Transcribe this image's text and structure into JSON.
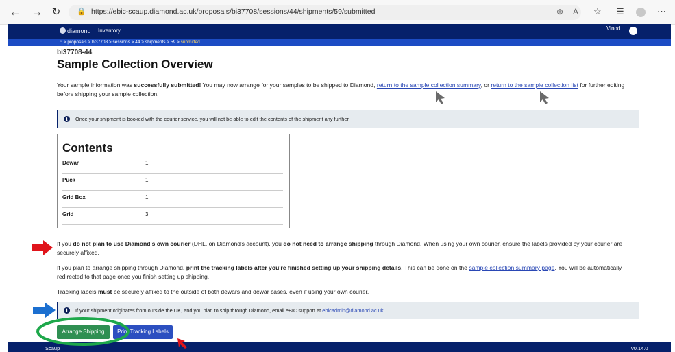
{
  "browser": {
    "url": "https://ebic-scaup.diamond.ac.uk/proposals/bi37708/sessions/44/shipments/59/submitted",
    "back_icon": "back-arrow-icon",
    "forward_icon": "forward-arrow-icon",
    "reload_icon": "reload-icon",
    "lock_icon": "lock-icon"
  },
  "app": {
    "logo_text": "diamond",
    "nav_inventory": "Inventory",
    "user_name": "Vinod",
    "accent_color": "#06216b",
    "crumb_color": "#1c4cc4"
  },
  "breadcrumb": {
    "home": "⌂",
    "sep": ">",
    "items": [
      "proposals",
      "bi37708",
      "sessions",
      "44",
      "shipments",
      "59",
      "submitted"
    ]
  },
  "page": {
    "proposal_session": "bi37708-44",
    "title": "Sample Collection Overview",
    "intro_pre": "Your sample information was ",
    "intro_bold": "successfully submitted!",
    "intro_mid": " You may now arrange for your samples to be shipped to Diamond, ",
    "intro_link1": "return to the sample collection summary",
    "intro_or": ", or ",
    "intro_link2": "return to the sample collection list",
    "intro_post": " for further editing before shipping your sample collection.",
    "alert_edit": "Once your shipment is booked with the courier service, you will not be able to edit the contents of the shipment any further.",
    "contents_title": "Contents",
    "contents": [
      {
        "label": "Dewar",
        "value": "1"
      },
      {
        "label": "Puck",
        "value": "1"
      },
      {
        "label": "Grid Box",
        "value": "1"
      },
      {
        "label": "Grid",
        "value": "3"
      }
    ],
    "p1_a": "If you ",
    "p1_b": "do not plan to use Diamond's own courier",
    "p1_c": " (DHL, on Diamond's account), you ",
    "p1_d": "do not need to arrange shipping",
    "p1_e": " through Diamond. When using your own courier, ensure the labels provided by your courier are securely affixed.",
    "p2_a": "If you plan to arrange shipping through Diamond, ",
    "p2_b": "print the tracking labels after you're finished setting up your shipping details",
    "p2_c": ". This can be done on the ",
    "p2_link": "sample collection summary page",
    "p2_d": ". You will be automatically redirected to that page once you finish setting up shipping.",
    "p3_a": "Tracking labels ",
    "p3_b": "must",
    "p3_c": " be securely affixed to the outside of both dewars and dewar cases, even if using your own courier.",
    "alert_uk_pre": "If your shipment originates from outside the UK, and you plan to ship through Diamond, email eBIC support at ",
    "alert_uk_email": "ebicadmin@diamond.ac.uk",
    "btn_arrange": "Arrange Shipping",
    "btn_print": "Print Tracking Labels",
    "btn_arrange_color": "#2f8f52",
    "btn_print_color": "#2c4fc0"
  },
  "footer": {
    "left": "Scaup",
    "version": "v0.14.0"
  },
  "annotations": {
    "red_arrow_color": "#e0141b",
    "blue_arrow_color": "#1b6fd0",
    "green_ellipse_color": "#1ea84b",
    "cursor_color": "#666666"
  }
}
